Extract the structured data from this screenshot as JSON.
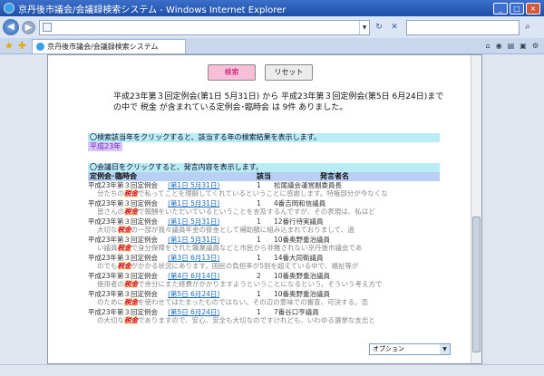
{
  "window": {
    "title": "京丹後市議会/会議録検索システム - Windows Internet Explorer"
  },
  "address": {
    "value": ""
  },
  "tab": {
    "label": "京丹後市議会/会議録検索システム"
  },
  "buttons": {
    "search": "検索",
    "reset": "リセット"
  },
  "summary": "平成23年第３回定例会(第1日 5月31日) から 平成23年第３回定例会(第5日 6月24日)までの中で 税金 が含まれている定例会･臨時会 は 9件 ありました。",
  "year_instruction": "〇検索該当年をクリックすると、該当する年の検索結果を表示します。",
  "year_link": "平成23年",
  "day_instruction": "〇会議日をクリックすると、発言内容を表示します。",
  "headers": {
    "session": "定例会･臨時会",
    "hits": "該当",
    "speaker": "発言者名"
  },
  "results": [
    {
      "session": "平成23年第３回定例会",
      "date": "(第1日 5月31日)",
      "count": "1",
      "speaker": "松尾議会運営副委員長",
      "pre": "分たちの",
      "kw": "税金",
      "post": "で私ってことを理解してくれているということに感謝します。特権部分が今なくな"
    },
    {
      "session": "平成23年第３回定例会",
      "date": "(第1日 5月31日)",
      "count": "1",
      "speaker": "4番吉岡和信議員",
      "pre": "皆さんの",
      "kw": "税金",
      "post": "で報酬をいただいているということを言及するんですが、その表現は、私はど"
    },
    {
      "session": "平成23年第３回定例会",
      "date": "(第1日 5月31日)",
      "count": "1",
      "speaker": "12番行待実議員",
      "pre": "大切な",
      "kw": "税金",
      "post": "の一部が我々議員年金の掛金として補助額に組み込まれておりまして、過"
    },
    {
      "session": "平成23年第３回定例会",
      "date": "(第1日 5月31日)",
      "count": "1",
      "speaker": "10番奥野重治議員",
      "pre": "い議員",
      "kw": "税金",
      "post": "で身分保障をされた職業議員などと市民から非難されない京丹後市議会であ"
    },
    {
      "session": "平成23年第３回定例会",
      "date": "(第3日 6月13日)",
      "count": "1",
      "speaker": "14番大同衛議員",
      "pre": "のでも",
      "kw": "税金",
      "post": "がかかる状況にあります。国民の負担率が5割を超えている中で、福祉等が"
    },
    {
      "session": "平成23年第３回定例会",
      "date": "(第4日 6月14日)",
      "count": "2",
      "speaker": "10番奥野重治議員",
      "pre": "使用者の",
      "kw": "税金",
      "post": "で余分にまた経費がかかりますようということになるという。そういう考え方で"
    },
    {
      "session": "平成23年第３回定例会",
      "date": "(第5日 6月24日)",
      "count": "1",
      "speaker": "10番奥野重治議員",
      "pre": "のために",
      "kw": "税金",
      "post": "を使わせてはたまったものではない。その辺の意味での審査、可決する。否"
    },
    {
      "session": "平成23年第３回定例会",
      "date": "(第5日 6月24日)",
      "count": "1",
      "speaker": "7番谷口亨議員",
      "pre": "の大切な",
      "kw": "税金",
      "post": "でありますので、安心、安全も大切なのですけれども、いわゆる選挙な支出と"
    }
  ],
  "option_select": {
    "value": "オプション"
  }
}
